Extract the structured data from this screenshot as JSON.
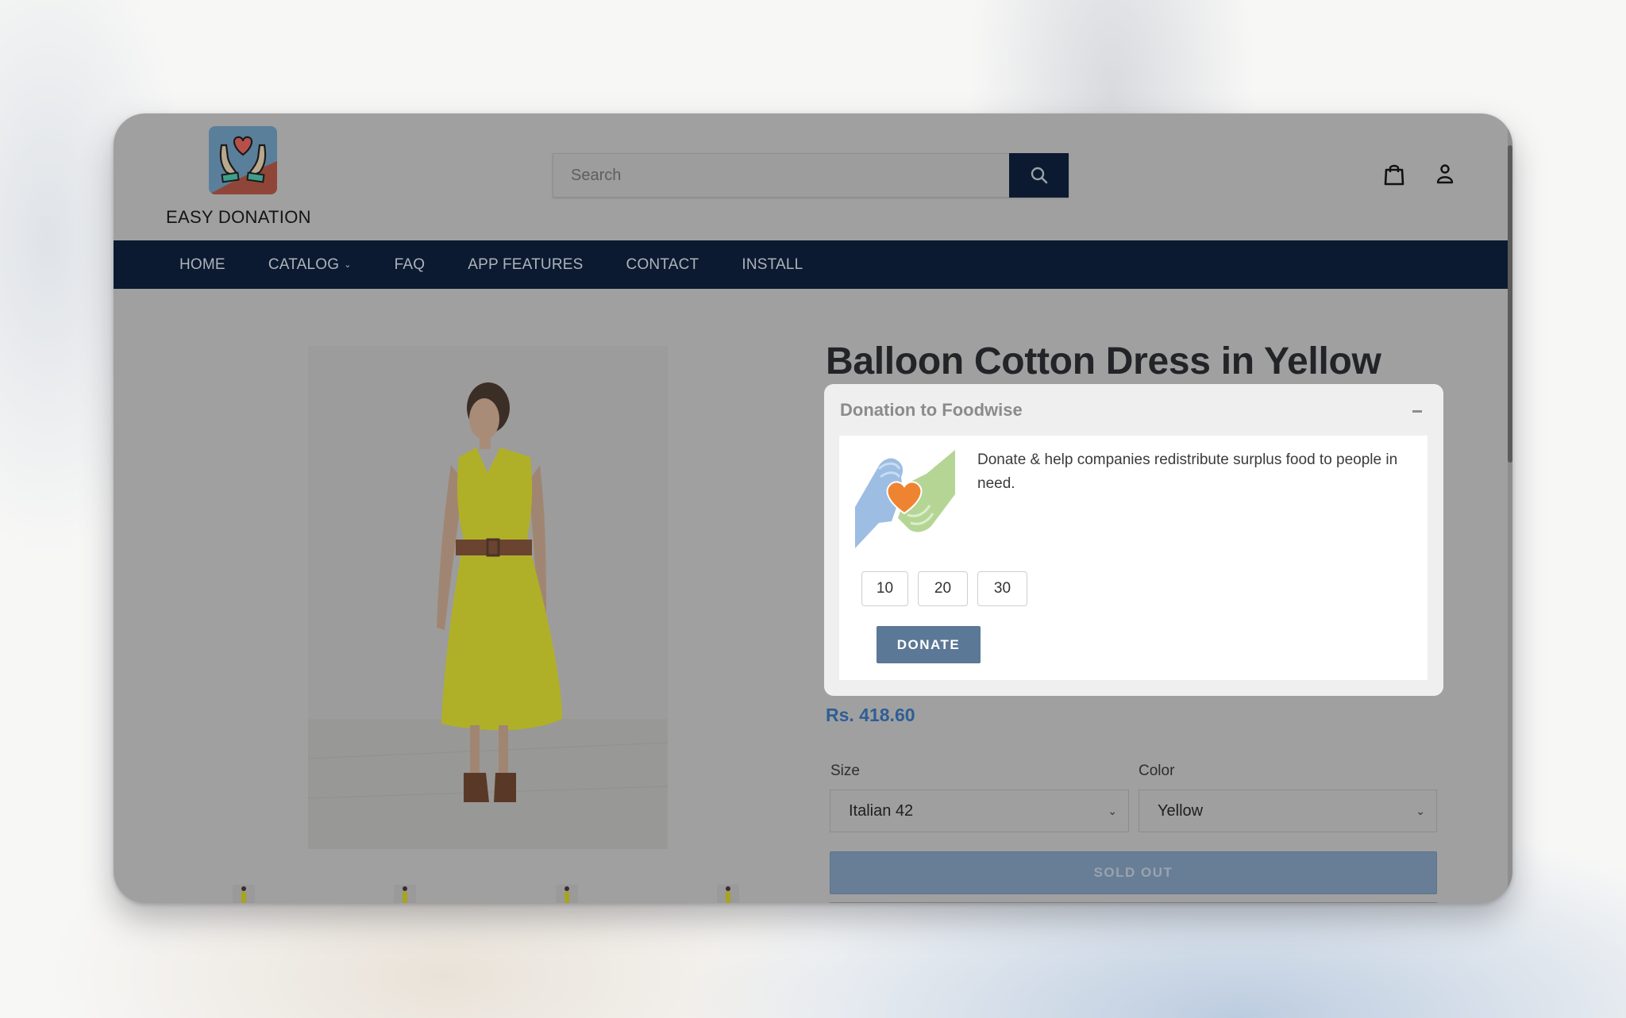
{
  "store": {
    "brand_name": "EASY DONATION",
    "logo_icon": "hands-heart-logo"
  },
  "search": {
    "placeholder": "Search",
    "value": "",
    "button_icon": "search-icon"
  },
  "header_icons": [
    {
      "name": "cart-icon",
      "label": "Cart"
    },
    {
      "name": "account-icon",
      "label": "Account"
    }
  ],
  "nav": {
    "items": [
      {
        "label": "HOME",
        "has_dropdown": false
      },
      {
        "label": "CATALOG",
        "has_dropdown": true
      },
      {
        "label": "FAQ",
        "has_dropdown": false
      },
      {
        "label": "APP FEATURES",
        "has_dropdown": false
      },
      {
        "label": "CONTACT",
        "has_dropdown": false
      },
      {
        "label": "INSTALL",
        "has_dropdown": false
      }
    ],
    "dropdown_glyph": "⌄"
  },
  "product": {
    "title": "Balloon Cotton Dress in Yellow",
    "price": "Rs. 418.60",
    "image_alt": "Woman wearing yellow sleeveless balloon cotton dress with brown belt",
    "thumbnail_count": 4,
    "options": {
      "size": {
        "label": "Size",
        "selected": "Italian 42"
      },
      "color": {
        "label": "Color",
        "selected": "Yellow"
      }
    },
    "sold_out_label": "SOLD OUT"
  },
  "donation": {
    "header": "Donation to Foodwise",
    "collapse_icon": "minus-icon",
    "description": "Donate & help companies redistribute surplus food to people in need.",
    "amounts": [
      "10",
      "20",
      "30"
    ],
    "donate_label": "DONATE"
  },
  "colors": {
    "nav_bg": "#0b1a30",
    "price": "#2e5e95",
    "donate_button": "#5b7896",
    "sold_out_button": "#687e97",
    "overlay_gray": "#a0a0a0"
  }
}
